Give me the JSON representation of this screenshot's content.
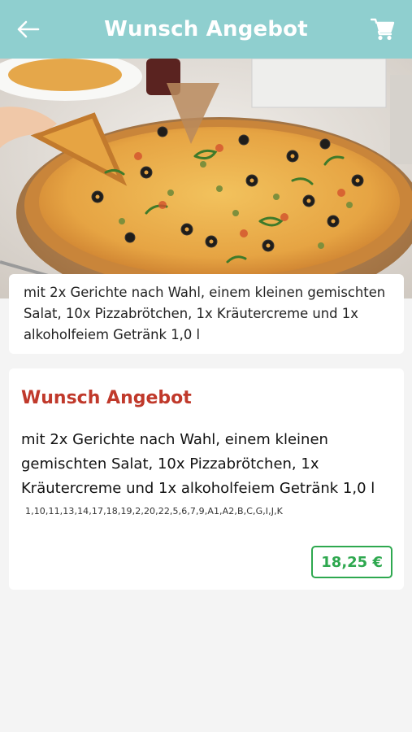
{
  "header": {
    "title": "Wunsch Angebot",
    "back_icon": "arrow-left-icon",
    "cart_icon": "shopping-cart-icon",
    "background_color": "#8fcfcf"
  },
  "hero": {
    "image": "pizza-photo",
    "description": "mit 2x Gerichte nach Wahl, einem kleinen gemischten Salat, 10x Pizzabrötchen, 1x Kräutercreme und 1x alkoholfeiem Getränk 1,0 l"
  },
  "product": {
    "title": "Wunsch Angebot",
    "description": "mit 2x Gerichte nach Wahl, einem kleinen gemischten Salat, 10x Pizzabrötchen, 1x Kräutercreme und 1x alkoholfeiem Getränk 1,0 l",
    "allergens": "1,10,11,13,14,17,18,19,2,20,22,5,6,7,9,A1,A2,B,C,G,I,J,K",
    "price": "18,25 €",
    "title_color": "#c0392b",
    "price_color": "#2ea84f"
  }
}
